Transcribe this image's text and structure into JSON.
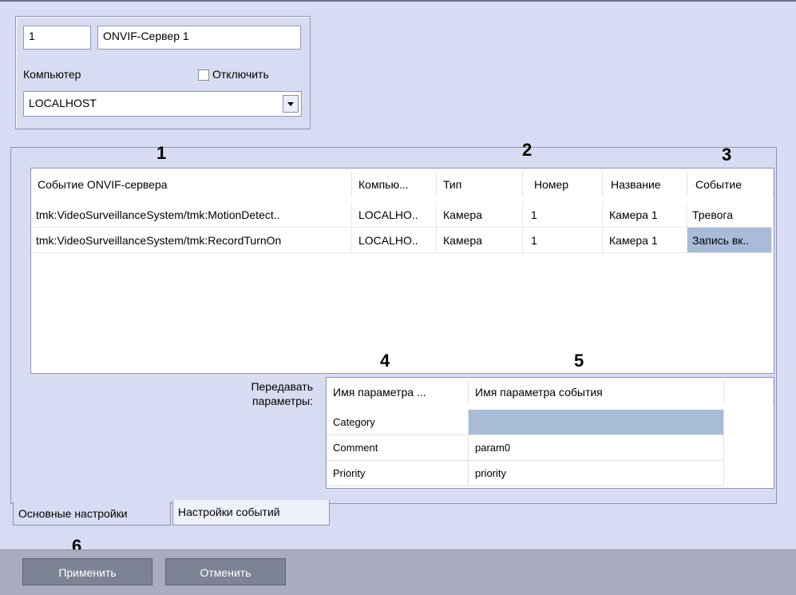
{
  "object": {
    "id": "1",
    "name": "ONVIF-Сервер 1",
    "computer_label": "Компьютер",
    "disable_label": "Отключить",
    "computer_value": "LOCALHOST"
  },
  "markers": [
    "1",
    "2",
    "3",
    "4",
    "5",
    "6"
  ],
  "events_table": {
    "columns": [
      "Событие ONVIF-сервера",
      "Компью...",
      "Тип",
      "Номер",
      "Название",
      "Событие"
    ],
    "rows": [
      [
        "tmk:VideoSurveillanceSystem/tmk:MotionDetect..",
        "LOCALHO..",
        "Камера",
        "1",
        "Камера 1",
        "Тревога"
      ],
      [
        "tmk:VideoSurveillanceSystem/tmk:RecordTurnOn",
        "LOCALHO..",
        "Камера",
        "1",
        "Камера 1",
        "Запись вк.."
      ]
    ]
  },
  "params": {
    "label": "Передавать параметры:",
    "columns": [
      "Имя параметра ...",
      "Имя параметра события"
    ],
    "rows": [
      [
        "Category",
        ""
      ],
      [
        "Comment",
        "param0"
      ],
      [
        "Priority",
        "priority"
      ]
    ]
  },
  "tabs": [
    "Основные настройки",
    "Настройки событий"
  ],
  "buttons": {
    "apply": "Применить",
    "cancel": "Отменить"
  },
  "colors": {
    "background": "#d8dcf2",
    "selection": "#a8bcd8",
    "button": "#7e8295"
  }
}
